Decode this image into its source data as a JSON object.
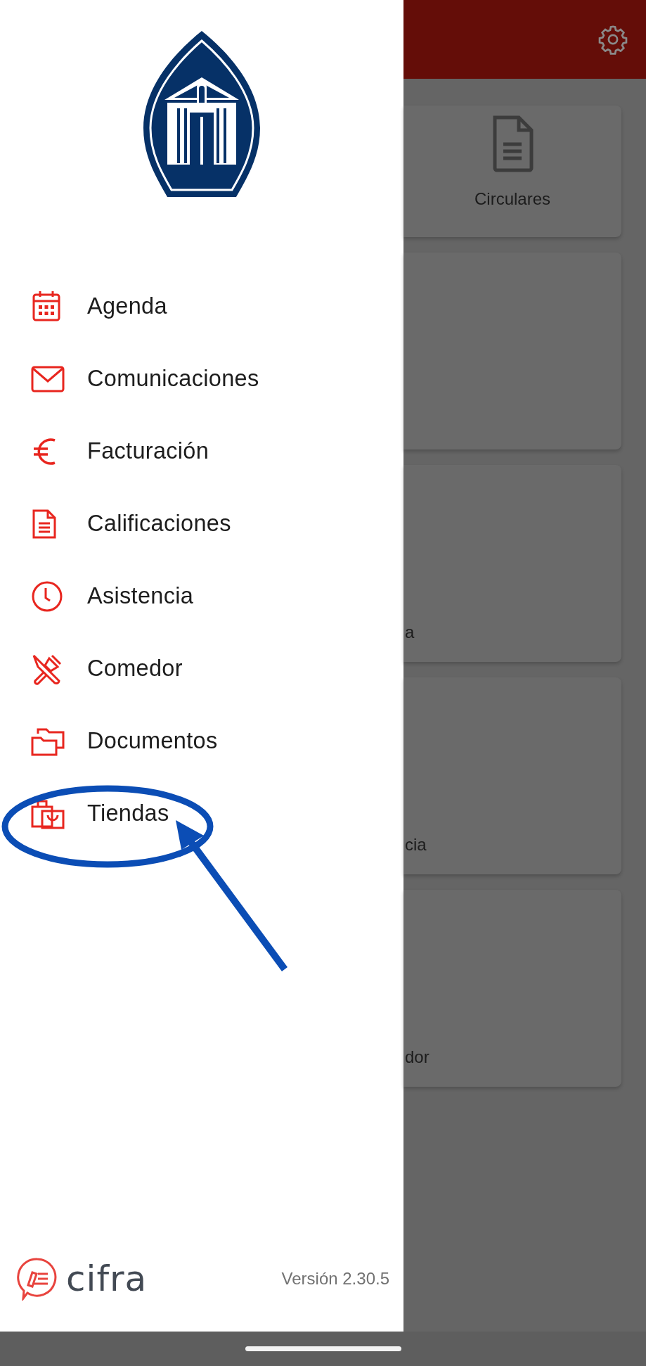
{
  "cards": [
    {
      "label": "Circulares",
      "kind": "half"
    },
    {
      "kind": "wide"
    },
    {
      "label": "a",
      "kind": "wide"
    },
    {
      "label": "cia",
      "kind": "wide"
    },
    {
      "label": "dor",
      "kind": "wide"
    }
  ],
  "drawer": {
    "items": [
      {
        "label": "Agenda"
      },
      {
        "label": "Comunicaciones"
      },
      {
        "label": "Facturación"
      },
      {
        "label": "Calificaciones"
      },
      {
        "label": "Asistencia"
      },
      {
        "label": "Comedor"
      },
      {
        "label": "Documentos"
      },
      {
        "label": "Tiendas"
      }
    ],
    "brand": "cifra",
    "version": "Versión 2.30.5"
  }
}
